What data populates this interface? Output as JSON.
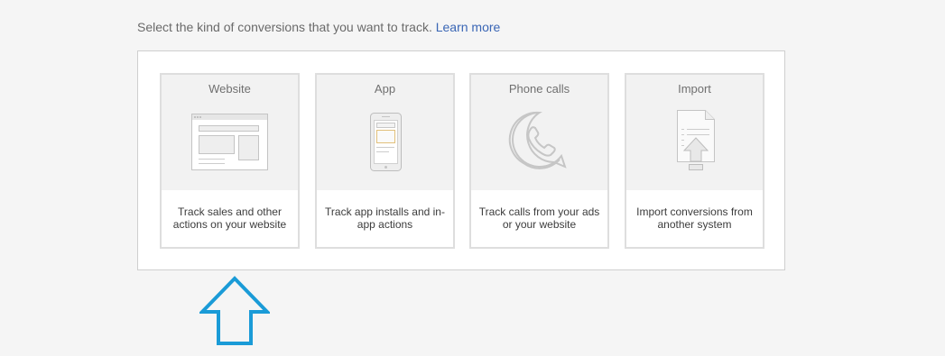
{
  "intro": {
    "text": "Select the kind of conversions that you want to track.",
    "link": "Learn more"
  },
  "cards": [
    {
      "title": "Website",
      "description": "Track sales and other actions on your website",
      "icon": "website-icon"
    },
    {
      "title": "App",
      "description": "Track app installs and in-app actions",
      "icon": "phone-icon"
    },
    {
      "title": "Phone calls",
      "description": "Track calls from your ads or your website",
      "icon": "phone-call-icon"
    },
    {
      "title": "Import",
      "description": "Import conversions from another system",
      "icon": "import-file-icon"
    }
  ],
  "colors": {
    "background": "#f5f5f5",
    "link": "#3a66b5",
    "arrow": "#1a9bd7",
    "card_border": "#dedede"
  }
}
